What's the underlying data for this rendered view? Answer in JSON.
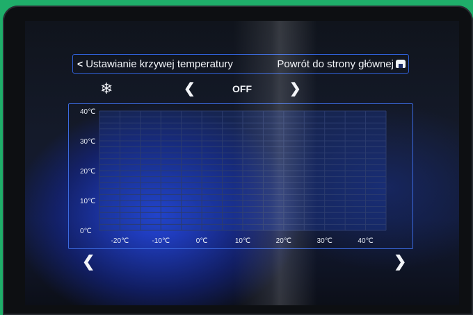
{
  "header": {
    "back_label": "Ustawianie krzywej temperatury",
    "back_icon": "chevron-left-icon",
    "home_label": "Powrót do strony głównej",
    "home_icon": "home-icon"
  },
  "mode": {
    "icon": "snowflake-icon",
    "value": "OFF"
  },
  "chart_data": {
    "type": "line",
    "title": "",
    "xlabel": "",
    "ylabel": "",
    "x_ticks": [
      "-20℃",
      "-10℃",
      "0℃",
      "10℃",
      "20℃",
      "30℃",
      "40℃"
    ],
    "y_ticks": [
      "0℃",
      "10℃",
      "20℃",
      "30℃",
      "40℃"
    ],
    "x_range": [
      -25,
      45
    ],
    "y_range": [
      0,
      40
    ],
    "grid": true,
    "series": []
  },
  "colors": {
    "accent": "#3b6ae0",
    "text": "#f2f4f8",
    "grid": "#2c3c6e"
  }
}
